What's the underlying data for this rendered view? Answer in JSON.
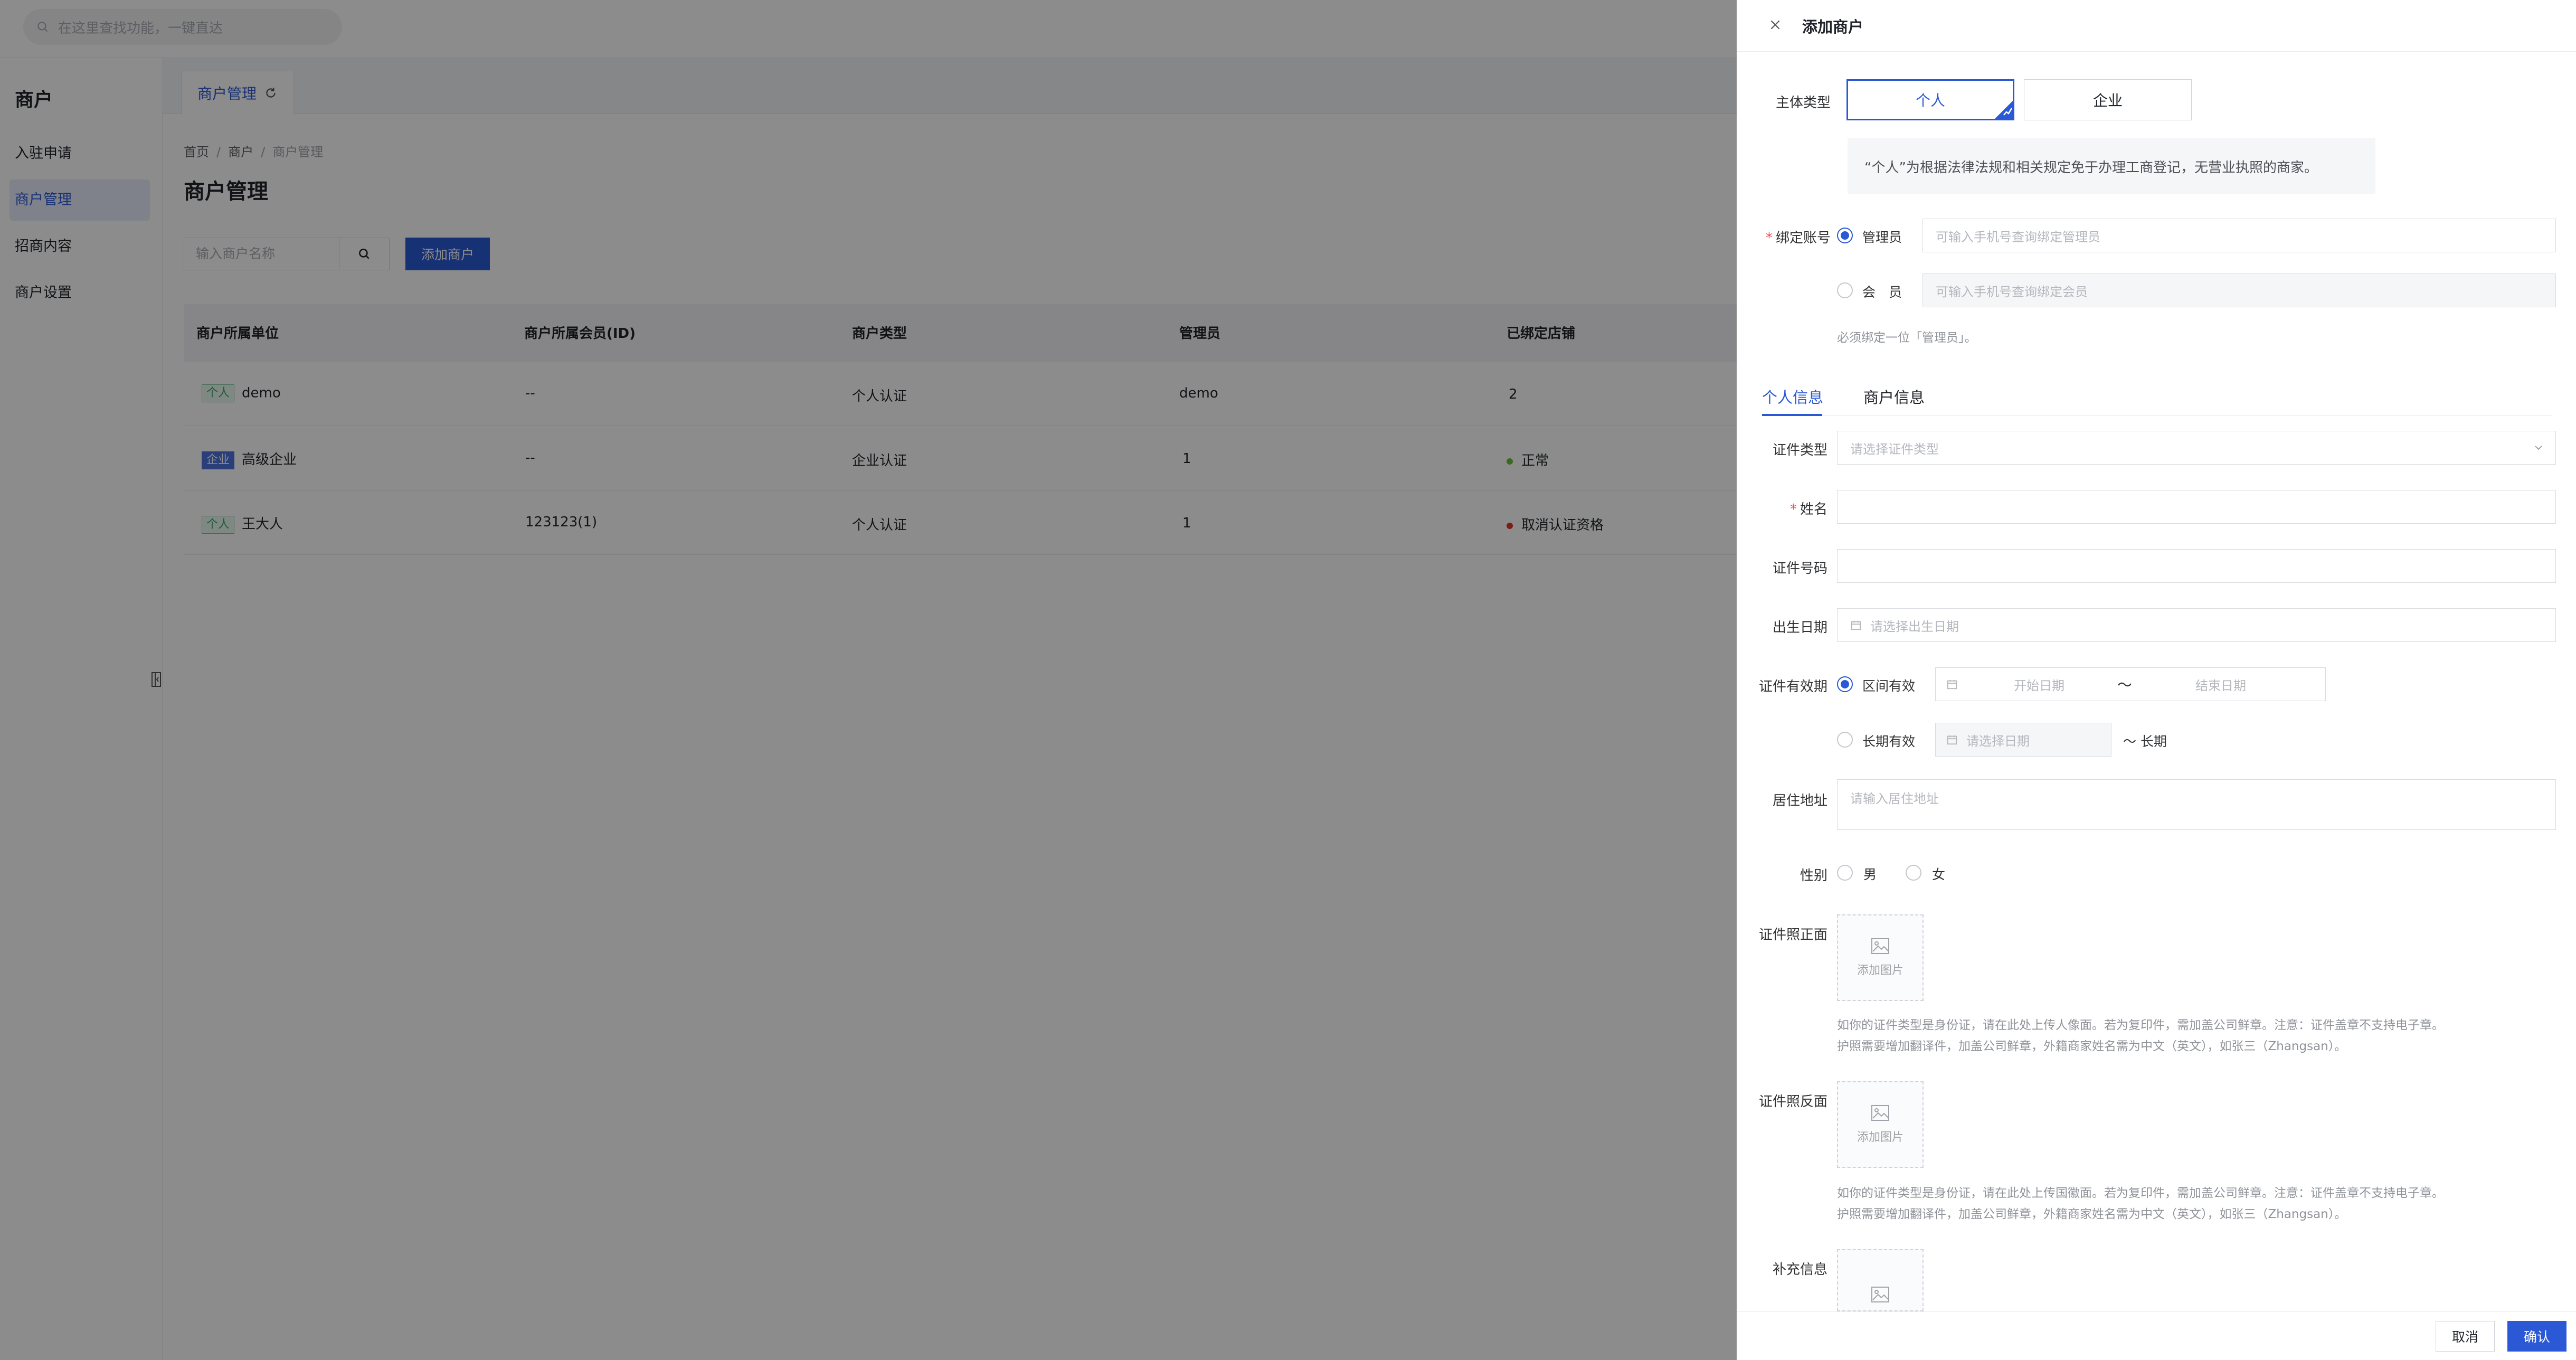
{
  "topbar": {
    "search_placeholder": "在这里查找功能，一键直达"
  },
  "sidebar": {
    "title": "商户",
    "items": [
      {
        "label": "入驻申请",
        "active": false
      },
      {
        "label": "商户管理",
        "active": true
      },
      {
        "label": "招商内容",
        "active": false
      },
      {
        "label": "商户设置",
        "active": false
      }
    ]
  },
  "page_tab": {
    "label": "商户管理"
  },
  "breadcrumb": [
    "首页",
    "商户",
    "商户管理"
  ],
  "page": {
    "title": "商户管理",
    "filter_placeholder": "输入商户名称",
    "add_button": "添加商户"
  },
  "table": {
    "columns": [
      "商户所属单位",
      "商户所属会员(ID)",
      "商户类型",
      "管理员",
      "已绑定店铺"
    ],
    "rows": [
      {
        "tag": "个人",
        "name": "demo",
        "member": "--",
        "type": "个人认证",
        "admin": "demo",
        "store": "2",
        "status_dot": ""
      },
      {
        "tag": "企业",
        "name": "高级企业",
        "member": "--",
        "type": "企业认证",
        "admin": "1",
        "store": "正常",
        "status_dot": "#67c23a"
      },
      {
        "tag": "个人",
        "name": "王大人",
        "member": "123123(1)",
        "type": "个人认证",
        "admin": "1",
        "store": "取消认证资格",
        "status_dot": "#e0362b"
      }
    ]
  },
  "drawer": {
    "title": "添加商户",
    "subject_type": {
      "label": "主体类型",
      "options": [
        "个人",
        "企业"
      ],
      "selected": "个人"
    },
    "subject_note": "“个人”为根据法律法规和相关规定免于办理工商登记，无营业执照的商家。",
    "bind_account": {
      "label": "绑定账号",
      "admin_label": "管理员",
      "admin_placeholder": "可输入手机号查询绑定管理员",
      "member_label": "会　员",
      "member_placeholder": "可输入手机号查询绑定会员",
      "hint": "必须绑定一位「管理员」。"
    },
    "tabs": [
      "个人信息",
      "商户信息"
    ],
    "fields": {
      "id_type_label": "证件类型",
      "id_type_placeholder": "请选择证件类型",
      "name_label": "姓名",
      "id_number_label": "证件号码",
      "birth_label": "出生日期",
      "birth_placeholder": "请选择出生日期",
      "validity_label": "证件有效期",
      "validity_range_option": "区间有效",
      "start_placeholder": "开始日期",
      "range_sep": "～",
      "end_placeholder": "结束日期",
      "validity_long_option": "长期有效",
      "long_date_placeholder": "请选择日期",
      "long_suffix": "～ 长期",
      "address_label": "居住地址",
      "address_placeholder": "请输入居住地址",
      "gender_label": "性别",
      "gender_options": [
        "男",
        "女"
      ],
      "front_label": "证件照正面",
      "upload_text": "添加图片",
      "front_hint_1": "如你的证件类型是身份证，请在此处上传人像面。若为复印件，需加盖公司鲜章。注意：证件盖章不支持电子章。",
      "front_hint_2": "护照需要增加翻译件，加盖公司鲜章，外籍商家姓名需为中文（英文），如张三（Zhangsan）。",
      "back_label": "证件照反面",
      "back_hint_1": "如你的证件类型是身份证，请在此处上传国徽面。若为复印件，需加盖公司鲜章。注意：证件盖章不支持电子章。",
      "back_hint_2": "护照需要增加翻译件，加盖公司鲜章，外籍商家姓名需为中文（英文），如张三（Zhangsan）。",
      "extra_label": "补充信息"
    },
    "footer": {
      "cancel": "取消",
      "confirm": "确认"
    }
  },
  "colors": {
    "accent": "#2b59d6",
    "overlay": "rgba(0,0,0,0.45)"
  }
}
